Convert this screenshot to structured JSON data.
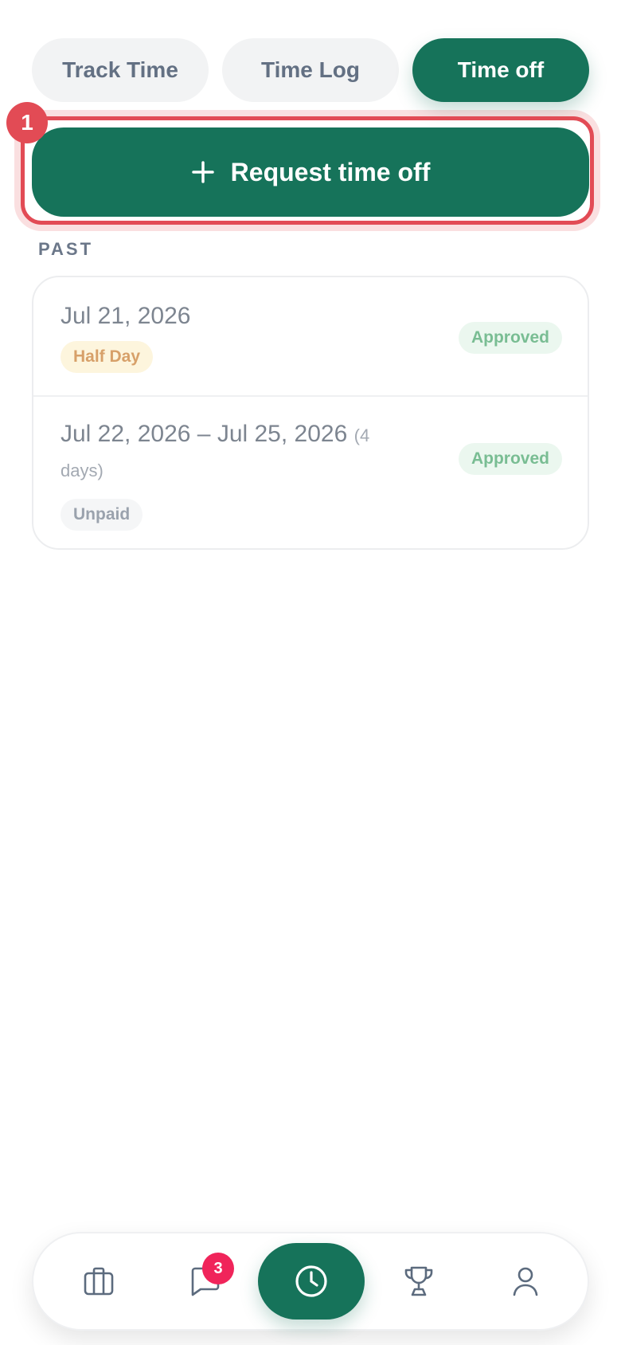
{
  "tabs": [
    {
      "label": "Track Time",
      "active": false
    },
    {
      "label": "Time Log",
      "active": false
    },
    {
      "label": "Time off",
      "active": true
    }
  ],
  "annotation": {
    "step": "1"
  },
  "request_button": {
    "label": "Request time off",
    "icon": "plus-icon"
  },
  "section": {
    "heading": "PAST"
  },
  "entries": [
    {
      "date": "Jul 21, 2026",
      "type": "Half Day",
      "status": "Approved"
    },
    {
      "date": "Jul 22, 2026 – Jul 25, 2026",
      "days_part1": "(4",
      "days_part2": "days)",
      "type": "Unpaid",
      "status": "Approved"
    }
  ],
  "bottom_nav": {
    "items": [
      "briefcase-icon",
      "chat-icon",
      "clock-icon",
      "trophy-icon",
      "user-icon"
    ],
    "messages_badge": "3"
  },
  "colors": {
    "brand": "#16735a",
    "highlight": "#e24b55",
    "badge": "#f0245a",
    "approved_text": "#79bd93",
    "half_day_text": "#d7a069"
  }
}
